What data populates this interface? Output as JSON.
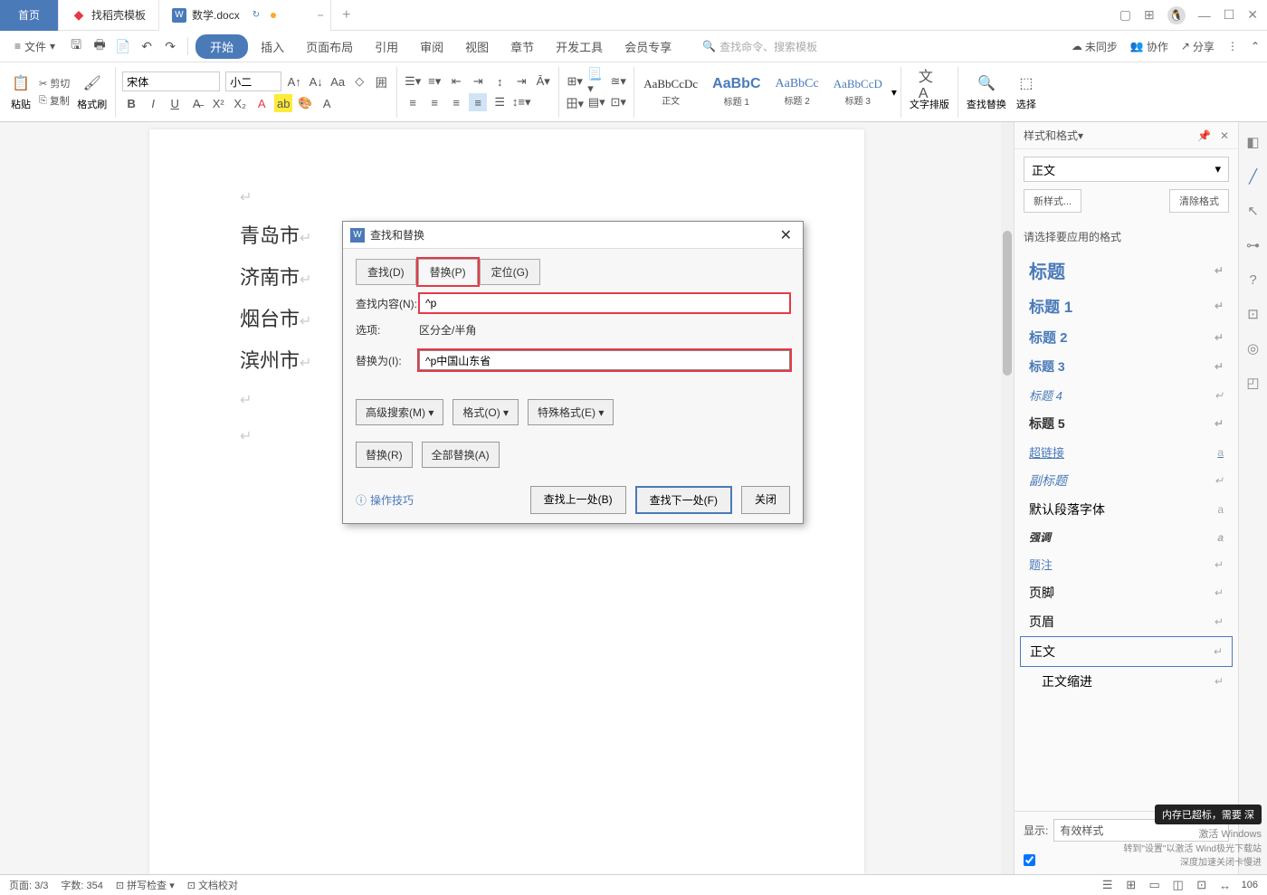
{
  "titlebar": {
    "home": "首页",
    "tab1": "找稻壳模板",
    "tab2": "数学.docx",
    "addtab": "+"
  },
  "menubar": {
    "file": "文件",
    "tabs": [
      "开始",
      "插入",
      "页面布局",
      "引用",
      "审阅",
      "视图",
      "章节",
      "开发工具",
      "会员专享"
    ],
    "search_ph": "查找命令、搜索模板",
    "right": {
      "sync": "未同步",
      "coop": "协作",
      "share": "分享"
    }
  },
  "ribbon": {
    "paste": "粘贴",
    "cut": "剪切",
    "copy": "复制",
    "brush": "格式刷",
    "font": "宋体",
    "size": "小二",
    "style_body": "正文",
    "style_h1": "标题 1",
    "style_h2": "标题 2",
    "style_h3": "标题 3",
    "textdir": "文字排版",
    "findrep": "查找替换",
    "select": "选择"
  },
  "doc": {
    "lines": [
      "青岛市",
      "济南市",
      "烟台市",
      "滨州市"
    ]
  },
  "dialog": {
    "title": "查找和替换",
    "tab_find": "查找(D)",
    "tab_replace": "替换(P)",
    "tab_goto": "定位(G)",
    "find_lbl": "查找内容(N):",
    "find_val": "^p",
    "opt_lbl": "选项:",
    "opt_val": "区分全/半角",
    "repl_lbl": "替换为(I):",
    "repl_val": "^p中国山东省",
    "adv": "高级搜索(M)",
    "format": "格式(O)",
    "special": "特殊格式(E)",
    "replace": "替换(R)",
    "replace_all": "全部替换(A)",
    "tips": "操作技巧",
    "find_prev": "查找上一处(B)",
    "find_next": "查找下一处(F)",
    "close": "关闭"
  },
  "rpanel": {
    "title": "样式和格式",
    "current": "正文",
    "new": "新样式...",
    "clear": "清除格式",
    "prompt": "请选择要应用的格式",
    "styles": [
      {
        "n": "标题",
        "cls": "h1"
      },
      {
        "n": "标题 1",
        "cls": "h2"
      },
      {
        "n": "标题 2",
        "cls": "h3"
      },
      {
        "n": "标题 3",
        "cls": "h4"
      },
      {
        "n": "标题 4",
        "cls": "h5"
      },
      {
        "n": "标题 5",
        "cls": "h6"
      },
      {
        "n": "超链接",
        "cls": "link"
      },
      {
        "n": "副标题",
        "cls": "sub"
      },
      {
        "n": "默认段落字体",
        "cls": ""
      },
      {
        "n": "强调",
        "cls": "em"
      },
      {
        "n": "题注",
        "cls": "tz"
      },
      {
        "n": "页脚",
        "cls": ""
      },
      {
        "n": "页眉",
        "cls": ""
      },
      {
        "n": "正文",
        "cls": "sel"
      },
      {
        "n": "正文缩进",
        "cls": "",
        "indent": true
      }
    ],
    "show_lbl": "显示:",
    "show_val": "有效样式"
  },
  "statusbar": {
    "page": "页面: 3/3",
    "words": "字数: 354",
    "spell": "拼写检查",
    "proof": "文档校对",
    "zoom": "106"
  },
  "wm": {
    "tip": "内存已超标，需要 深",
    "l1": "激活 Windows",
    "l2": "转到\"设置\"以激活 Wind极光下载站",
    "l3": "深度加速关闭卡慢进"
  }
}
